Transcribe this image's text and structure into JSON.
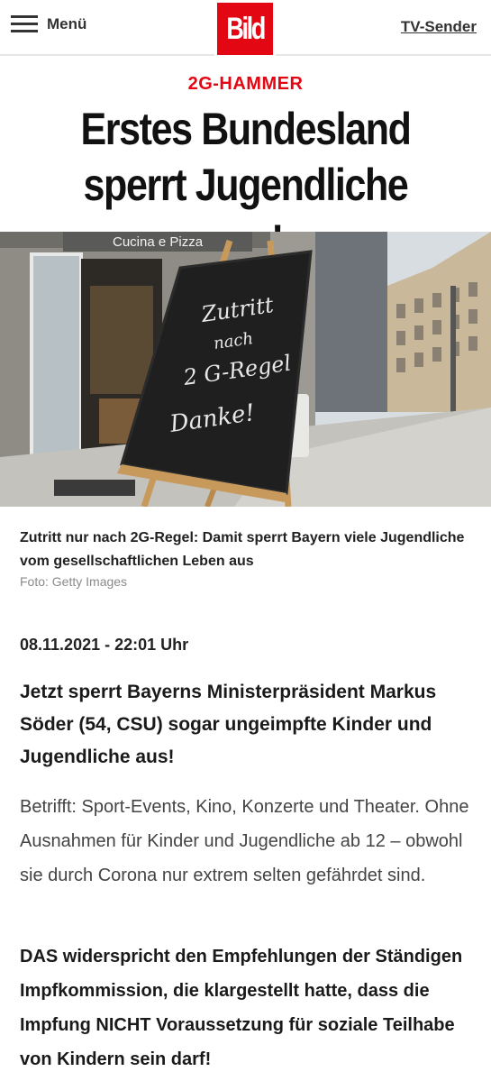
{
  "header": {
    "menu_label": "Menü",
    "logo_text": "Bild",
    "tv_label": "TV-Sender"
  },
  "article": {
    "kicker": "2G-HAMMER",
    "headline": "Erstes Bundesland sperrt Jugendliche aus!",
    "image": {
      "shop_sign": "Cucina e Pizza",
      "board_lines": [
        "Zutritt",
        "nach",
        "2 G-Regel",
        "Danke!"
      ]
    },
    "caption": "Zutritt nur nach 2G-Regel: Damit sperrt Bayern viele Jugendliche vom gesellschaftlichen Leben aus",
    "credit": "Foto: Getty Images",
    "date": "08.11.2021 - 22:01 Uhr",
    "lead": "Jetzt sperrt Bayerns Ministerpräsident Markus Söder (54, CSU) sogar ungeimpfte Kinder und Jugendliche aus!",
    "body1": "Betrifft: Sport-Events, Kino, Konzerte und Theater. Ohne Ausnahmen für Kinder und Jugendliche ab 12 – obwohl sie durch Corona nur extrem selten gefährdet sind.",
    "body2": "DAS widerspricht den Empfehlungen der Ständigen Impfkommission, die klargestellt hatte, dass die Impfung NICHT Voraussetzung für soziale Teilhabe von Kindern sein darf!"
  },
  "colors": {
    "brand_red": "#e30613",
    "text_dark": "#111111",
    "text_body": "#444444",
    "credit_gray": "#8a8a8a"
  }
}
